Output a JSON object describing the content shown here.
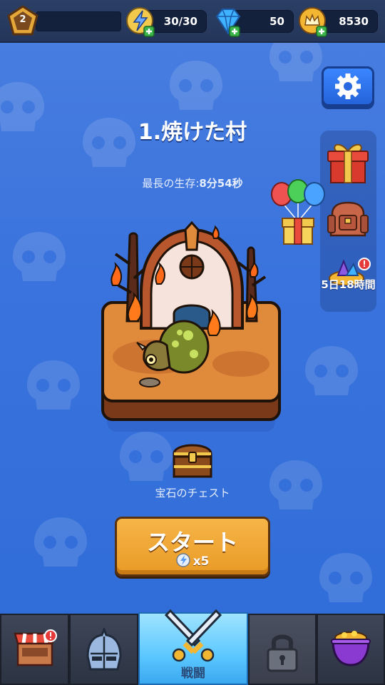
{
  "player": {
    "level": "2"
  },
  "resources": {
    "energy": {
      "value": "30/30",
      "icon": "lightning-bolt-icon"
    },
    "gems": {
      "value": "50",
      "icon": "blue-diamond-icon"
    },
    "gold": {
      "value": "8530",
      "icon": "gold-crown-coin-icon"
    }
  },
  "stage": {
    "title": "1.焼けた村",
    "best_survival_label": "最長の生存:",
    "best_survival_value": "8分54秒"
  },
  "side": {
    "timer": "5日18時間"
  },
  "chest": {
    "label": "宝石のチェスト"
  },
  "start_button": {
    "label": "スタート",
    "cost": "x5"
  },
  "nav": {
    "tabs": [
      {
        "id": "shop",
        "icon": "shop-stall-icon",
        "alert": true
      },
      {
        "id": "equipment",
        "icon": "knight-helmet-icon"
      },
      {
        "id": "battle",
        "icon": "crossed-swords-icon",
        "label": "戦闘",
        "active": true
      },
      {
        "id": "locked",
        "icon": "padlock-icon"
      },
      {
        "id": "cauldron",
        "icon": "gold-cauldron-icon"
      }
    ]
  },
  "colors": {
    "background": "#3a73dd",
    "topbar": "#24365a",
    "start_button": "#f0a535",
    "active_tab": "#5cc8ff"
  }
}
